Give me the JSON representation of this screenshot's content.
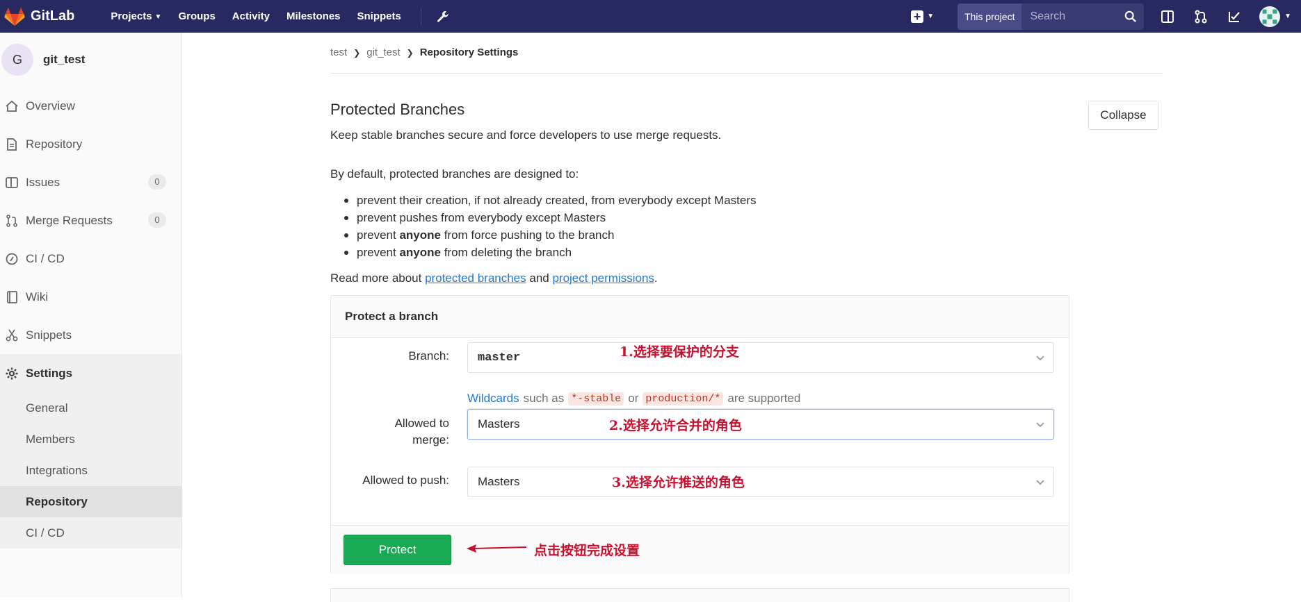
{
  "navbar": {
    "brand": "GitLab",
    "links": [
      "Projects",
      "Groups",
      "Activity",
      "Milestones",
      "Snippets"
    ],
    "search_scope": "This project",
    "search_placeholder": "Search",
    "colors": {
      "bg": "#292961"
    }
  },
  "sidebar": {
    "project_initial": "G",
    "project_name": "git_test",
    "items": [
      {
        "label": "Overview",
        "icon": "home-icon"
      },
      {
        "label": "Repository",
        "icon": "doc-icon"
      },
      {
        "label": "Issues",
        "icon": "issues-icon",
        "badge": "0"
      },
      {
        "label": "Merge Requests",
        "icon": "merge-request-icon",
        "badge": "0"
      },
      {
        "label": "CI / CD",
        "icon": "rocket-icon"
      },
      {
        "label": "Wiki",
        "icon": "book-icon"
      },
      {
        "label": "Snippets",
        "icon": "scissors-icon"
      }
    ],
    "settings": {
      "label": "Settings",
      "icon": "gear-icon",
      "sub": [
        "General",
        "Members",
        "Integrations",
        "Repository",
        "CI / CD"
      ],
      "active_sub": "Repository"
    }
  },
  "breadcrumb": [
    "test",
    "git_test",
    "Repository Settings"
  ],
  "section": {
    "title": "Protected Branches",
    "description": "Keep stable branches secure and force developers to use merge requests.",
    "collapse": "Collapse",
    "intro": "By default, protected branches are designed to:",
    "bullets": [
      {
        "before": "prevent their creation, if not already created, from everybody except Masters",
        "bold": "",
        "after": ""
      },
      {
        "before": "prevent pushes from everybody except Masters",
        "bold": "",
        "after": ""
      },
      {
        "before": "prevent ",
        "bold": "anyone",
        "after": " from force pushing to the branch"
      },
      {
        "before": "prevent ",
        "bold": "anyone",
        "after": " from deleting the branch"
      }
    ],
    "read_more": {
      "prefix": "Read more about ",
      "link1": "protected branches",
      "mid": " and ",
      "link2": "project permissions",
      "suffix": "."
    }
  },
  "panel": {
    "title": "Protect a branch",
    "branch_label": "Branch:",
    "branch_value": "master",
    "help": {
      "wildcards": "Wildcards",
      "such_as": "such as",
      "code1": "*-stable",
      "or": "or",
      "code2": "production/*",
      "tail": "are supported"
    },
    "merge_label_1": "Allowed to",
    "merge_label_2": "merge:",
    "merge_value": "Masters",
    "push_label": "Allowed to push:",
    "push_value": "Masters",
    "protect_button": "Protect"
  },
  "annotations": {
    "step1": "1.选择要保护的分支",
    "step2": "2.选择允许合并的角色",
    "step3": "3.选择允许推送的角色",
    "click": "点击按钮完成设置",
    "color": "#c8102e"
  }
}
